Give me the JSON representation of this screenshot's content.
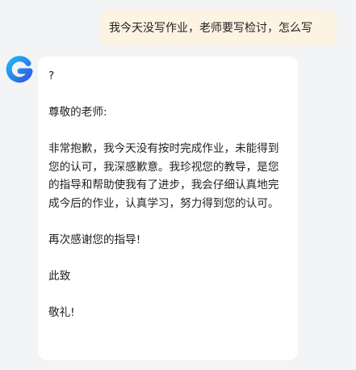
{
  "user_message": {
    "text": "我今天没写作业，老师要写检讨，怎么写"
  },
  "assistant": {
    "avatar_icon": "g-logo-icon",
    "accent_colors": [
      "#2f6bf2",
      "#1fb6f5"
    ],
    "paragraphs": [
      "?",
      "尊敬的老师:",
      "非常抱歉，我今天没有按时完成作业，未能得到您的认可，我深感歉意。我珍视您的教导，是您的指导和帮助使我有了进步，我会仔细认真地完成今后的作业，认真学习，努力得到您的认可。",
      "再次感谢您的指导!",
      "此致",
      "敬礼!"
    ]
  }
}
